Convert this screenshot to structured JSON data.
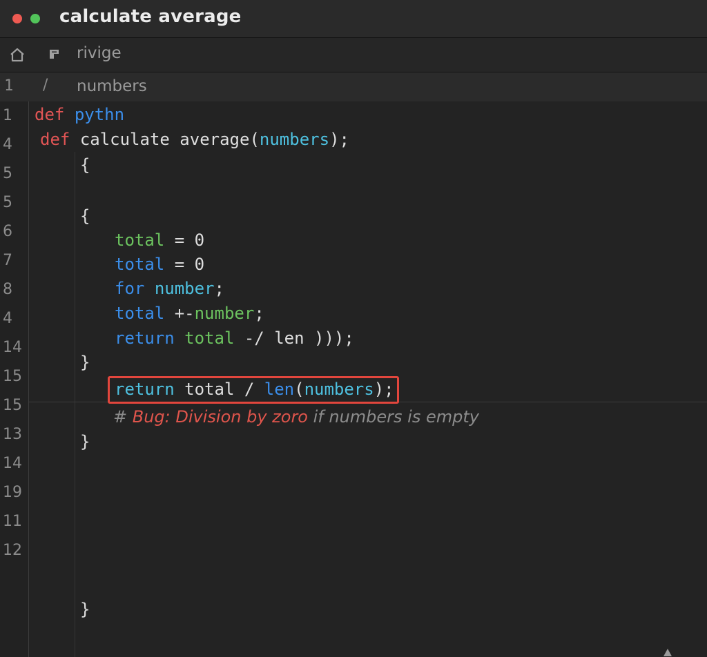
{
  "window": {
    "title": "calculate average"
  },
  "nav": {
    "label": "rivige"
  },
  "path": {
    "line_number": "1",
    "separator": "/",
    "label": "numbers"
  },
  "gutter": [
    "1",
    "4",
    "5",
    "5",
    "6",
    "7",
    "8",
    "4",
    "14",
    "15",
    "15",
    "13",
    "14",
    "19",
    "11",
    "12"
  ],
  "code": {
    "l1_def": "def",
    "l1_name": "pythn",
    "l2_def": "def",
    "l2_name": "calculate average(",
    "l2_param": "numbers",
    "l2_end": ");",
    "l3": "{",
    "l4": "{",
    "l5_var": "total",
    "l5_rest": " = 0",
    "l6_var": "total",
    "l6_rest": " = 0",
    "l7_for": "for",
    "l7_var": "number",
    "l7_end": ";",
    "l8_var": "total",
    "l8_op": " +-",
    "l8_num": "number",
    "l8_end": ";",
    "l9_return": "return",
    "l9_var": "total",
    "l9_rest": " -/ len )));",
    "l10": "}",
    "l11_return": "return",
    "l11_mid": " total / ",
    "l11_len": "len",
    "l11_open": "(",
    "l11_param": "numbers",
    "l11_end": ");",
    "l12_hash": "# ",
    "l12_bug": "Bug: Division by zoro",
    "l12_rest": " if numbers is empty",
    "l13": "}",
    "l14": "}"
  },
  "colors": {
    "keyword_red": "#e25555",
    "keyword_blue": "#3b8eea",
    "cyan": "#4ec1e0",
    "green": "#6cc35f",
    "highlight": "#e2463d"
  },
  "icons": [
    "home-icon",
    "file-icon"
  ]
}
